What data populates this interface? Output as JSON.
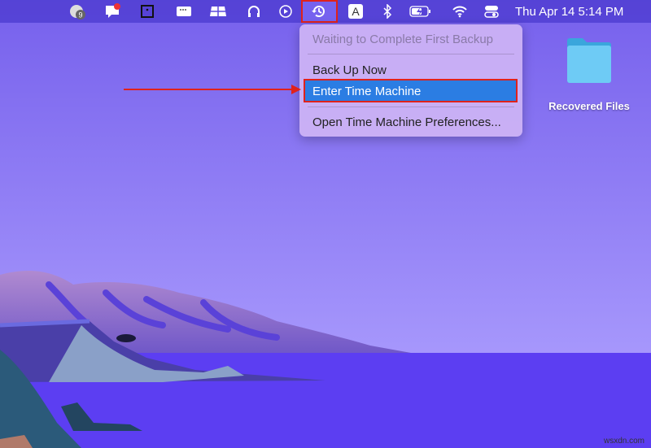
{
  "menubar": {
    "items": [
      {
        "icon": "badge-clock-icon",
        "badge": "9"
      },
      {
        "icon": "phone-chat-icon"
      },
      {
        "icon": "square-frame-icon"
      },
      {
        "icon": "window-dots-icon"
      },
      {
        "icon": "workspace-icon"
      },
      {
        "icon": "headphones-icon"
      },
      {
        "icon": "play-circle-icon"
      },
      {
        "icon": "time-machine-icon"
      },
      {
        "icon": "input-source-icon",
        "label": "A"
      },
      {
        "icon": "bluetooth-icon"
      },
      {
        "icon": "battery-charging-icon"
      },
      {
        "icon": "wifi-icon"
      },
      {
        "icon": "control-center-icon"
      }
    ],
    "clock": "Thu Apr 14  5:14 PM"
  },
  "menu": {
    "status": "Waiting to Complete First Backup",
    "items": [
      "Back Up Now",
      "Enter Time Machine",
      "Open Time Machine Preferences..."
    ],
    "highlight_color": "#2b7de3"
  },
  "desktop": {
    "folder_label": "Recovered Files"
  },
  "annotation_color": "#e0221b",
  "watermark": "wsxdn.com"
}
